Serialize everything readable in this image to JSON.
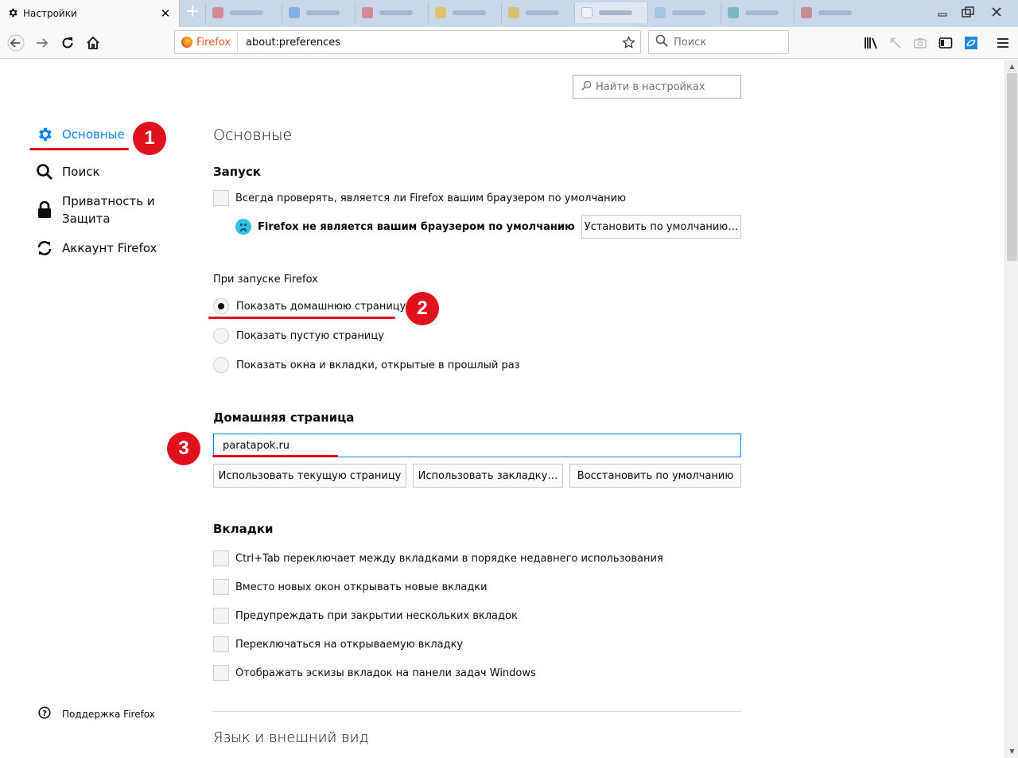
{
  "tab": {
    "title": "Настройки",
    "close": "✕"
  },
  "new_tab_symbol": "+",
  "window": {
    "minimize": "–",
    "restore": "❐",
    "close": "✕"
  },
  "urlbar": {
    "identity": "Firefox",
    "url": "about:preferences"
  },
  "searchbar": {
    "placeholder": "Поиск"
  },
  "find": {
    "placeholder": "Найти в настройках"
  },
  "sidebar": {
    "items": [
      {
        "label": "Основные",
        "icon": "gear-icon",
        "selected": true
      },
      {
        "label": "Поиск",
        "icon": "search-icon"
      },
      {
        "label": "Приватность и",
        "label2": "Защита",
        "icon": "lock-icon"
      },
      {
        "label": "Аккаунт Firefox",
        "icon": "sync-icon"
      }
    ],
    "support": "Поддержка Firefox"
  },
  "main": {
    "title": "Основные",
    "startup": {
      "heading": "Запуск",
      "default_check": "Всегда проверять, является ли Firefox вашим браузером по умолчанию",
      "not_default": "Firefox не является вашим браузером по умолчанию",
      "set_default_btn": "Установить по умолчанию…",
      "on_start_label": "При запуске Firefox",
      "options": [
        {
          "label": "Показать домашнюю страницу",
          "selected": true
        },
        {
          "label": "Показать пустую страницу",
          "selected": false
        },
        {
          "label": "Показать окна и вкладки, открытые в прошлый раз",
          "selected": false
        }
      ]
    },
    "homepage": {
      "heading": "Домашняя страница",
      "value": "paratapok.ru",
      "buttons": [
        "Использовать текущую страницу",
        "Использовать закладку…",
        "Восстановить по умолчанию"
      ]
    },
    "tabs": {
      "heading": "Вкладки",
      "options": [
        "Ctrl+Tab переключает между вкладками в порядке недавнего использования",
        "Вместо новых окон открывать новые вкладки",
        "Предупреждать при закрытии нескольких вкладок",
        "Переключаться на открываемую вкладку",
        "Отображать эскизы вкладок на панели задач Windows"
      ]
    },
    "language_heading": "Язык и внешний вид"
  },
  "annotations": [
    "1",
    "2",
    "3"
  ],
  "colors": {
    "accent": "#0a84ff",
    "annotation": "#e0101c"
  }
}
